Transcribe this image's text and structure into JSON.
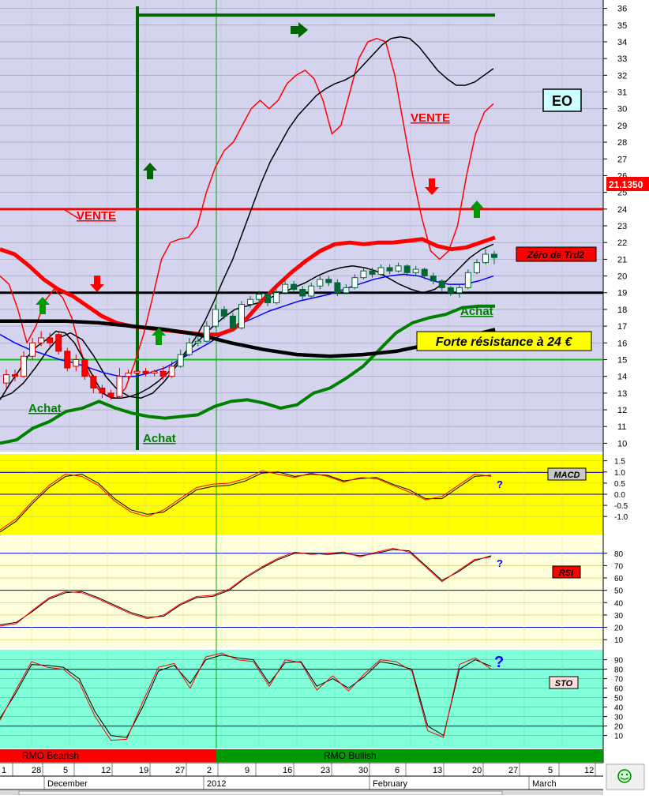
{
  "chart_data": [
    {
      "type": "candlestick",
      "title": "EO",
      "last_price": "21.1350",
      "ylim": [
        9.5,
        36.5
      ],
      "y_ticks": [
        10,
        11,
        12,
        13,
        14,
        15,
        16,
        17,
        18,
        19,
        20,
        21,
        22,
        23,
        24,
        25,
        26,
        27,
        28,
        29,
        30,
        31,
        32,
        33,
        34,
        35,
        36
      ],
      "candles": [
        {
          "o": 13.6,
          "c": 14.1,
          "h": 14.4,
          "l": 13.3
        },
        {
          "o": 14.1,
          "c": 14.0,
          "h": 14.4,
          "l": 13.7
        },
        {
          "o": 14.0,
          "c": 15.2,
          "h": 15.5,
          "l": 13.9
        },
        {
          "o": 15.2,
          "c": 16.0,
          "h": 16.3,
          "l": 15.0
        },
        {
          "o": 16.0,
          "c": 16.3,
          "h": 16.7,
          "l": 15.8
        },
        {
          "o": 16.3,
          "c": 16.0,
          "h": 16.6,
          "l": 15.7
        },
        {
          "o": 16.5,
          "c": 15.5,
          "h": 16.7,
          "l": 15.3
        },
        {
          "o": 15.5,
          "c": 14.5,
          "h": 15.7,
          "l": 14.3
        },
        {
          "o": 14.6,
          "c": 15.0,
          "h": 15.3,
          "l": 14.3
        },
        {
          "o": 15.0,
          "c": 14.0,
          "h": 15.1,
          "l": 13.8
        },
        {
          "o": 14.0,
          "c": 13.3,
          "h": 14.1,
          "l": 13.0
        },
        {
          "o": 13.3,
          "c": 13.0,
          "h": 13.5,
          "l": 12.7
        },
        {
          "o": 13.0,
          "c": 12.8,
          "h": 13.2,
          "l": 12.6
        },
        {
          "o": 12.8,
          "c": 14.0,
          "h": 14.5,
          "l": 12.7
        },
        {
          "o": 14.0,
          "c": 14.2,
          "h": 14.4,
          "l": 13.8
        },
        {
          "o": 14.2,
          "c": 14.3,
          "h": 14.5,
          "l": 14.0
        },
        {
          "o": 14.3,
          "c": 14.2,
          "h": 14.5,
          "l": 14.0
        },
        {
          "o": 14.2,
          "c": 14.3,
          "h": 14.4,
          "l": 14.0
        },
        {
          "o": 14.3,
          "c": 14.0,
          "h": 14.6,
          "l": 13.8
        },
        {
          "o": 14.0,
          "c": 14.6,
          "h": 14.9,
          "l": 13.9
        },
        {
          "o": 14.6,
          "c": 15.3,
          "h": 15.6,
          "l": 14.5
        },
        {
          "o": 15.3,
          "c": 16.0,
          "h": 16.3,
          "l": 15.2
        },
        {
          "o": 16.0,
          "c": 16.1,
          "h": 16.4,
          "l": 15.8
        },
        {
          "o": 16.1,
          "c": 17.0,
          "h": 17.3,
          "l": 16.0
        },
        {
          "o": 17.0,
          "c": 18.0,
          "h": 18.3,
          "l": 16.9
        },
        {
          "o": 18.0,
          "c": 17.6,
          "h": 18.2,
          "l": 17.4
        },
        {
          "o": 17.6,
          "c": 16.9,
          "h": 17.8,
          "l": 16.7
        },
        {
          "o": 16.9,
          "c": 18.3,
          "h": 18.5,
          "l": 16.8
        },
        {
          "o": 18.3,
          "c": 18.6,
          "h": 18.8,
          "l": 18.1
        },
        {
          "o": 18.6,
          "c": 18.9,
          "h": 19.1,
          "l": 18.4
        },
        {
          "o": 18.9,
          "c": 18.4,
          "h": 19.0,
          "l": 18.2
        },
        {
          "o": 18.4,
          "c": 19.0,
          "h": 19.2,
          "l": 18.3
        },
        {
          "o": 19.0,
          "c": 19.5,
          "h": 19.8,
          "l": 18.9
        },
        {
          "o": 19.5,
          "c": 19.2,
          "h": 19.7,
          "l": 19.0
        },
        {
          "o": 19.2,
          "c": 18.8,
          "h": 19.4,
          "l": 18.6
        },
        {
          "o": 18.8,
          "c": 19.4,
          "h": 19.6,
          "l": 18.7
        },
        {
          "o": 19.4,
          "c": 19.8,
          "h": 20.0,
          "l": 19.2
        },
        {
          "o": 19.8,
          "c": 19.6,
          "h": 20.0,
          "l": 19.4
        },
        {
          "o": 19.6,
          "c": 19.0,
          "h": 19.8,
          "l": 18.8
        },
        {
          "o": 19.0,
          "c": 19.3,
          "h": 19.5,
          "l": 18.9
        },
        {
          "o": 19.3,
          "c": 19.9,
          "h": 20.1,
          "l": 19.2
        },
        {
          "o": 19.9,
          "c": 20.3,
          "h": 20.5,
          "l": 19.8
        },
        {
          "o": 20.3,
          "c": 20.1,
          "h": 20.5,
          "l": 19.9
        },
        {
          "o": 20.1,
          "c": 20.5,
          "h": 20.7,
          "l": 20.0
        },
        {
          "o": 20.5,
          "c": 20.3,
          "h": 20.7,
          "l": 20.1
        },
        {
          "o": 20.3,
          "c": 20.6,
          "h": 20.8,
          "l": 20.2
        },
        {
          "o": 20.6,
          "c": 20.2,
          "h": 20.7,
          "l": 20.0
        },
        {
          "o": 20.2,
          "c": 20.4,
          "h": 20.6,
          "l": 20.0
        },
        {
          "o": 20.4,
          "c": 20.0,
          "h": 20.5,
          "l": 19.8
        },
        {
          "o": 20.0,
          "c": 19.7,
          "h": 20.2,
          "l": 19.5
        },
        {
          "o": 19.7,
          "c": 19.3,
          "h": 19.8,
          "l": 19.1
        },
        {
          "o": 19.3,
          "c": 19.0,
          "h": 19.4,
          "l": 18.8
        },
        {
          "o": 19.0,
          "c": 19.3,
          "h": 19.5,
          "l": 18.7
        },
        {
          "o": 19.3,
          "c": 20.2,
          "h": 20.4,
          "l": 19.2
        },
        {
          "o": 20.2,
          "c": 20.8,
          "h": 21.0,
          "l": 20.1
        },
        {
          "o": 20.8,
          "c": 21.3,
          "h": 21.6,
          "l": 20.7
        },
        {
          "o": 21.3,
          "c": 21.1,
          "h": 21.5,
          "l": 20.7
        }
      ],
      "series": [
        {
          "color": "#ff0000",
          "values": [
            20.0,
            19.5,
            18.0,
            16.0,
            17.0,
            18.5,
            19.2,
            18.7,
            17.5,
            15.5,
            14.0,
            13.2,
            12.8,
            12.7,
            13.3,
            14.8,
            16.5,
            18.7,
            21.0,
            22.0,
            22.2,
            22.3,
            23.0,
            25.0,
            26.5,
            27.5,
            28.0,
            29.0,
            30.0,
            30.5,
            30.0,
            30.5,
            31.5,
            32.0,
            32.3,
            31.8,
            30.5,
            28.5,
            29.0,
            31.0,
            33.0,
            34.0,
            34.2,
            34.0,
            32.0,
            29.0,
            26.0,
            23.5,
            21.5,
            21.0,
            21.5,
            23.0,
            26.0,
            28.5,
            29.8,
            30.3
          ]
        },
        {
          "color": "#000000",
          "values": [
            12.6,
            13.5,
            14.3,
            15.2,
            15.8,
            16.2,
            16.7,
            16.6,
            16.0,
            15.0,
            14.0,
            13.0,
            12.7,
            12.7,
            12.8,
            13.0,
            13.3,
            13.7,
            14.2,
            14.8,
            15.5,
            16.3,
            17.3,
            18.5,
            19.8,
            21.0,
            22.5,
            24.0,
            25.5,
            26.8,
            27.8,
            28.8,
            29.6,
            30.2,
            30.8,
            31.2,
            31.5,
            31.7,
            32.0,
            32.6,
            33.2,
            33.8,
            34.2,
            34.3,
            34.2,
            33.7,
            33.0,
            32.3,
            31.8,
            31.4,
            31.4,
            31.6,
            32.0,
            32.4
          ]
        },
        {
          "color": "#000000",
          "values": [
            12.7,
            13.0,
            13.6,
            14.5,
            15.5,
            16.3,
            16.6,
            16.2,
            15.2,
            14.0,
            13.2,
            12.8,
            12.7,
            13.0,
            13.7,
            14.6,
            15.5,
            16.2,
            16.9,
            17.5,
            18.0,
            18.2,
            18.4,
            18.7,
            19.0,
            19.3,
            19.6,
            20.0,
            20.3,
            20.5,
            20.6,
            20.5,
            20.3,
            19.9,
            19.5,
            19.2,
            19.0,
            19.2,
            19.7,
            20.4,
            21.1,
            21.6,
            21.9
          ]
        },
        {
          "color": "#0000ff",
          "values": [
            16.5,
            16.0,
            15.6,
            15.3,
            15.0,
            14.8,
            14.5,
            14.2,
            14.0,
            14.0,
            14.2,
            14.5,
            15.0,
            15.5,
            16.0,
            16.6,
            17.1,
            17.5,
            17.9,
            18.2,
            18.5,
            18.7,
            18.9,
            19.2,
            19.5,
            19.8,
            20.0,
            20.1,
            20.0,
            19.7,
            19.5,
            19.5,
            19.7,
            20.0
          ]
        },
        {
          "color": "#ff0000",
          "values": [
            21.6,
            21.3,
            20.6,
            19.8,
            19.2,
            18.8,
            18.2,
            17.6,
            17.2,
            17.0,
            16.9,
            16.8,
            16.7,
            16.6,
            16.5,
            16.5,
            16.8,
            17.5,
            18.5,
            19.4,
            20.2,
            20.9,
            21.5,
            21.9,
            22.0,
            21.9,
            22.0,
            22.0,
            22.1,
            22.2,
            21.8,
            21.6,
            21.7,
            22.0,
            22.3
          ]
        },
        {
          "color": "#008000",
          "values": [
            10.0,
            10.2,
            10.9,
            11.3,
            11.9,
            12.1,
            12.5,
            12.1,
            11.8,
            11.6,
            11.5,
            11.6,
            11.7,
            12.2,
            12.5,
            12.6,
            12.4,
            12.1,
            12.3,
            13.0,
            13.3,
            13.9,
            14.6,
            15.6,
            16.6,
            17.2,
            17.5,
            17.7,
            18.1,
            18.2,
            18.2
          ]
        },
        {
          "color": "#000000",
          "values": [
            17.3,
            17.3,
            17.3,
            17.2,
            17.0,
            16.8,
            16.5,
            16.0,
            15.6,
            15.3,
            15.2,
            15.3,
            15.5,
            15.9,
            16.3,
            16.8
          ]
        }
      ],
      "hlines": [
        {
          "y": 24.0,
          "color": "#ff0000"
        },
        {
          "y": 19.0,
          "color": "#000000"
        },
        {
          "y": 15.0,
          "color": "#00cc00"
        },
        {
          "y": 35.6,
          "color": "#006600"
        }
      ],
      "annotations": [
        {
          "text": "VENTE",
          "color": "#ff0000"
        },
        {
          "text": "VENTE",
          "color": "#ff0000"
        },
        {
          "text": "Achat",
          "color": "#008000"
        },
        {
          "text": "Achat",
          "color": "#008000"
        },
        {
          "text": "Achat",
          "color": "#008000"
        },
        {
          "text": "Zéro de Trd2",
          "color": "#ff0000"
        },
        {
          "text": "Forte résistance à 24 €",
          "color": "#ffff00"
        }
      ]
    },
    {
      "type": "line",
      "title": "MACD",
      "ylim": [
        -1.7,
        1.7
      ],
      "y_ticks": [
        "1.5",
        "1.0",
        "0.5",
        "0.0",
        "-0.5",
        "-1.0"
      ],
      "y_tick_values": [
        1.5,
        1.0,
        0.5,
        0.0,
        -0.5,
        -1.0
      ],
      "hlines": [
        0.0,
        0.98
      ],
      "annotation": "?",
      "series": [
        {
          "color": "#000000",
          "values": [
            -1.7,
            -1.2,
            -0.4,
            0.3,
            0.8,
            0.9,
            0.5,
            -0.2,
            -0.7,
            -0.9,
            -0.8,
            -0.3,
            0.2,
            0.35,
            0.4,
            0.6,
            0.95,
            1.0,
            0.8,
            0.9,
            0.85,
            0.6,
            0.7,
            0.75,
            0.45,
            0.2,
            -0.2,
            -0.2,
            0.3,
            0.8,
            0.85
          ]
        },
        {
          "color": "#ff0000",
          "values": [
            -1.6,
            -1.1,
            -0.3,
            0.4,
            0.9,
            0.8,
            0.4,
            -0.3,
            -0.8,
            -1.0,
            -0.7,
            -0.2,
            0.3,
            0.45,
            0.5,
            0.7,
            1.05,
            0.9,
            0.75,
            0.95,
            0.8,
            0.55,
            0.75,
            0.7,
            0.4,
            0.1,
            -0.25,
            -0.1,
            0.4,
            0.9,
            0.8
          ]
        }
      ]
    },
    {
      "type": "line",
      "title": "RSI",
      "ylim": [
        5,
        92
      ],
      "y_ticks": [
        "80",
        "70",
        "60",
        "50",
        "40",
        "30",
        "20",
        "10"
      ],
      "y_tick_values": [
        80,
        70,
        60,
        50,
        40,
        30,
        20,
        10
      ],
      "hlines": [
        80,
        50,
        20
      ],
      "annotation": "?",
      "series": [
        {
          "color": "#000000",
          "values": [
            22,
            24,
            33,
            43,
            48,
            49,
            44,
            38,
            32,
            28,
            29,
            38,
            44,
            45,
            50,
            60,
            68,
            75,
            80,
            80,
            79,
            80,
            78,
            80,
            83,
            82,
            70,
            58,
            65,
            74,
            78
          ]
        },
        {
          "color": "#ff0000",
          "values": [
            21,
            23,
            34,
            44,
            49,
            48,
            43,
            37,
            31,
            27,
            30,
            39,
            45,
            46,
            51,
            61,
            69,
            76,
            81,
            79,
            80,
            81,
            77,
            81,
            84,
            81,
            69,
            57,
            66,
            75,
            77
          ]
        }
      ]
    },
    {
      "type": "line",
      "title": "STO",
      "ylim": [
        -2,
        98
      ],
      "y_ticks": [
        "90",
        "80",
        "70",
        "60",
        "50",
        "40",
        "30",
        "20",
        "10"
      ],
      "y_tick_values": [
        90,
        80,
        70,
        60,
        50,
        40,
        30,
        20,
        10
      ],
      "hlines": [
        80,
        20
      ],
      "annotation": "?",
      "series": [
        {
          "color": "#000000",
          "values": [
            28,
            55,
            85,
            84,
            82,
            70,
            35,
            10,
            8,
            40,
            78,
            84,
            65,
            90,
            95,
            92,
            90,
            65,
            87,
            88,
            62,
            70,
            60,
            72,
            88,
            85,
            80,
            20,
            10,
            80,
            90,
            83
          ]
        },
        {
          "color": "#ff0000",
          "values": [
            26,
            58,
            88,
            82,
            80,
            66,
            30,
            5,
            6,
            45,
            82,
            86,
            60,
            93,
            97,
            90,
            88,
            62,
            90,
            87,
            58,
            73,
            57,
            75,
            90,
            88,
            78,
            15,
            8,
            85,
            92,
            80
          ]
        }
      ],
      "bands": [
        {
          "text": "RMO Bearish",
          "color": "#ff0000"
        },
        {
          "text": "RMO Bullish",
          "color": "#009900"
        }
      ]
    }
  ],
  "x_axis": {
    "day_labels": [
      "1",
      "28",
      "5",
      "12",
      "19",
      "27",
      "2",
      "9",
      "16",
      "23",
      "30",
      "6",
      "13",
      "20",
      "27",
      "5",
      "12"
    ],
    "month_labels": [
      "December",
      "2012",
      "February",
      "March"
    ]
  },
  "icons": {
    "status": "smiley-icon"
  }
}
